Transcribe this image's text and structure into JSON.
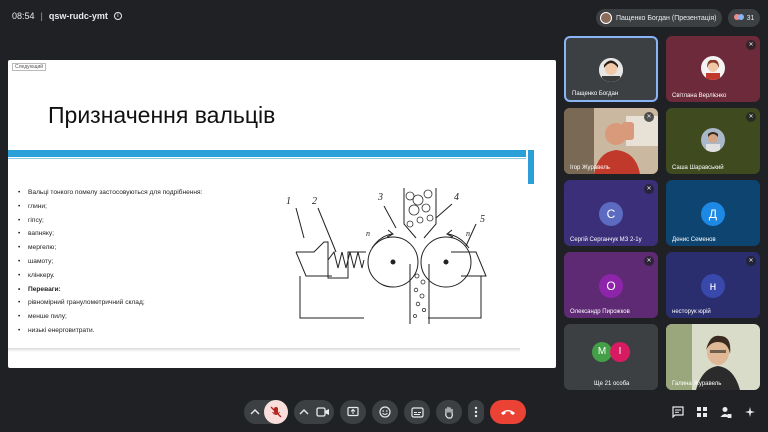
{
  "top": {
    "time": "08:54",
    "separator": "|",
    "meeting_code": "qsw-rudc-ymt",
    "presenter_label": "Пащенко Богдан (Презентація)",
    "participant_count": "31"
  },
  "slide": {
    "next_badge": "Следующий",
    "title": "Призначення вальців",
    "bullets": [
      "Вальці тонкого помелу застосовуються для подрібнення:",
      "глини;",
      "гіпсу;",
      "вапняку;",
      "мергелю;",
      "шамоту;",
      "клінкеру.",
      "Переваги:",
      "рівномірний гранулометричний склад;",
      "менше пилу;",
      "низькі енерговитрати."
    ],
    "diagram_labels": [
      "1",
      "2",
      "3",
      "4",
      "5",
      "n",
      "n"
    ]
  },
  "participants": [
    {
      "name": "Пащенко Богдан",
      "kind": "photo",
      "active": true,
      "muted": false
    },
    {
      "name": "Світлана Верлієнко",
      "kind": "photo",
      "active": false,
      "muted": true
    },
    {
      "name": "Ігор Журавель",
      "kind": "camera",
      "active": false,
      "muted": true
    },
    {
      "name": "Саша Шаравський",
      "kind": "photo",
      "active": false,
      "muted": true
    },
    {
      "name": "Сергій Серганчук МЗ 2-1у",
      "kind": "letter",
      "letter": "С",
      "color": "#5c6bc0",
      "muted": true
    },
    {
      "name": "Денис Семенов",
      "kind": "letter",
      "letter": "Д",
      "color": "#1e88e5",
      "muted": false
    },
    {
      "name": "Олександр Пирожков",
      "kind": "letter",
      "letter": "О",
      "color": "#8e24aa",
      "muted": true
    },
    {
      "name": "несторук юрій",
      "kind": "letter",
      "letter": "н",
      "color": "#3949ab",
      "muted": true
    },
    {
      "name": "Ще 21 особа",
      "kind": "more",
      "letters": [
        "М",
        "І"
      ],
      "colors": [
        "#43a047",
        "#d81b60"
      ],
      "muted": false
    },
    {
      "name": "Галина Журавель",
      "kind": "camera",
      "active": false,
      "muted": false
    }
  ],
  "controls": {
    "mic_muted": true,
    "end_call_color": "#ea4335",
    "icons": [
      "chevron-up-icon",
      "mic-off-icon",
      "chevron-up-icon",
      "camera-icon",
      "present-icon",
      "emoji-icon",
      "captions-icon",
      "raise-hand-icon",
      "more-icon",
      "end-call-icon",
      "chat-icon",
      "activities-icon",
      "host-controls-icon",
      "companion-icon"
    ]
  }
}
